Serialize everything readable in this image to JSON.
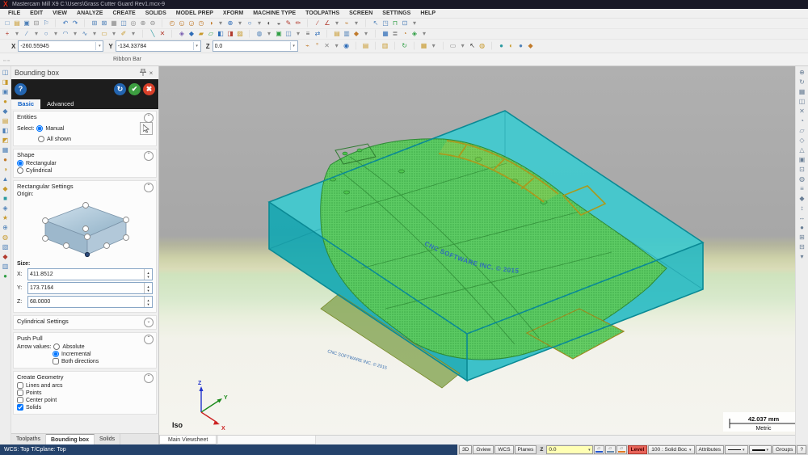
{
  "window": {
    "title": "Mastercam Mill X9   C:\\Users\\Grass Cutter Guard Rev1.mcx-9"
  },
  "menu": {
    "items": [
      "FILE",
      "EDIT",
      "VIEW",
      "ANALYZE",
      "CREATE",
      "SOLIDS",
      "MODEL PREP",
      "XFORM",
      "MACHINE TYPE",
      "TOOLPATHS",
      "SCREEN",
      "SETTINGS",
      "HELP"
    ]
  },
  "toolbars": {
    "row1": [
      {
        "g": "□",
        "c": "#4f81b8"
      },
      {
        "g": "▤",
        "c": "#c8992b"
      },
      {
        "g": "▣",
        "c": "#4f81b8"
      },
      {
        "g": "⊟",
        "c": "#8a8a8a"
      },
      {
        "g": "⚐",
        "c": "#4f81b8"
      },
      {
        "g": "│",
        "c": "#d5d5d5"
      },
      {
        "g": "↶",
        "c": "#2f6db8"
      },
      {
        "g": "↷",
        "c": "#2f6db8"
      },
      {
        "g": "│",
        "c": "#d5d5d5"
      },
      {
        "g": "⊞",
        "c": "#4f81b8"
      },
      {
        "g": "⊠",
        "c": "#4f81b8"
      },
      {
        "g": "▦",
        "c": "#8a8a8a"
      },
      {
        "g": "◫",
        "c": "#4f81b8"
      },
      {
        "g": "◎",
        "c": "#8a8a8a"
      },
      {
        "g": "⊕",
        "c": "#8a8a8a"
      },
      {
        "g": "⊖",
        "c": "#8a8a8a"
      },
      {
        "g": "│",
        "c": "#d5d5d5"
      },
      {
        "g": "◴",
        "c": "#c07a2a"
      },
      {
        "g": "◵",
        "c": "#c07a2a"
      },
      {
        "g": "◶",
        "c": "#c07a2a"
      },
      {
        "g": "◷",
        "c": "#c07a2a"
      },
      {
        "g": "◑",
        "c": "#c07a2a"
      },
      {
        "g": "▾",
        "c": "#888888"
      },
      {
        "g": "⊕",
        "c": "#2f6db8"
      },
      {
        "g": "▾",
        "c": "#888888"
      },
      {
        "g": "○",
        "c": "#2f6db8"
      },
      {
        "g": "▾",
        "c": "#888888"
      },
      {
        "g": "◐",
        "c": "#555555"
      },
      {
        "g": "◒",
        "c": "#555555"
      },
      {
        "g": "✎",
        "c": "#b23b2e"
      },
      {
        "g": "✏",
        "c": "#b23b2e"
      },
      {
        "g": "│",
        "c": "#d5d5d5"
      },
      {
        "g": "∕",
        "c": "#b23b2e"
      },
      {
        "g": "∠",
        "c": "#b23b2e"
      },
      {
        "g": "▾",
        "c": "#888888"
      },
      {
        "g": "⌁",
        "c": "#c07a2a"
      },
      {
        "g": "▾",
        "c": "#888888"
      },
      {
        "g": "│",
        "c": "#d5d5d5"
      },
      {
        "g": "↖",
        "c": "#4f81b8"
      },
      {
        "g": "◳",
        "c": "#4f81b8"
      },
      {
        "g": "⊓",
        "c": "#2f9e44"
      },
      {
        "g": "⊡",
        "c": "#4f81b8"
      },
      {
        "g": "▾",
        "c": "#888888"
      }
    ],
    "row2": [
      {
        "g": "+",
        "c": "#b23b2e"
      },
      {
        "g": "▾",
        "c": "#888888"
      },
      {
        "g": "∕",
        "c": "#4f81b8"
      },
      {
        "g": "▾",
        "c": "#888888"
      },
      {
        "g": "○",
        "c": "#4f81b8"
      },
      {
        "g": "▾",
        "c": "#888888"
      },
      {
        "g": "◠",
        "c": "#4f81b8"
      },
      {
        "g": "▾",
        "c": "#888888"
      },
      {
        "g": "∿",
        "c": "#4f81b8"
      },
      {
        "g": "▾",
        "c": "#888888"
      },
      {
        "g": "▭",
        "c": "#c8992b"
      },
      {
        "g": "▾",
        "c": "#888888"
      },
      {
        "g": "✐",
        "c": "#c8992b"
      },
      {
        "g": "▾",
        "c": "#888888"
      },
      {
        "g": "│",
        "c": "#d5d5d5"
      },
      {
        "g": "╲",
        "c": "#2b9aa0"
      },
      {
        "g": "✕",
        "c": "#b23b2e"
      },
      {
        "g": "│",
        "c": "#d5d5d5"
      },
      {
        "g": "◈",
        "c": "#7a5fb0"
      },
      {
        "g": "◆",
        "c": "#2f6db8"
      },
      {
        "g": "▰",
        "c": "#c8992b"
      },
      {
        "g": "▱",
        "c": "#2f9e44"
      },
      {
        "g": "◧",
        "c": "#2f6db8"
      },
      {
        "g": "◨",
        "c": "#b23b2e"
      },
      {
        "g": "▨",
        "c": "#c8992b"
      },
      {
        "g": "│",
        "c": "#d5d5d5"
      },
      {
        "g": "◍",
        "c": "#4f81b8"
      },
      {
        "g": "▾",
        "c": "#888888"
      },
      {
        "g": "▣",
        "c": "#2f9e44"
      },
      {
        "g": "◫",
        "c": "#4f81b8"
      },
      {
        "g": "▾",
        "c": "#888888"
      },
      {
        "g": "≡",
        "c": "#555555"
      },
      {
        "g": "⇄",
        "c": "#2f6db8"
      },
      {
        "g": "│",
        "c": "#d5d5d5"
      },
      {
        "g": "▤",
        "c": "#c8992b"
      },
      {
        "g": "▥",
        "c": "#4f81b8"
      },
      {
        "g": "◆",
        "c": "#c07a2a"
      },
      {
        "g": "▾",
        "c": "#888888"
      },
      {
        "g": "│",
        "c": "#d5d5d5"
      },
      {
        "g": "▦",
        "c": "#2f6db8"
      },
      {
        "g": "≣",
        "c": "#555555"
      },
      {
        "g": "◔",
        "c": "#c07a2a"
      },
      {
        "g": "◈",
        "c": "#2f9e44"
      },
      {
        "g": "▾",
        "c": "#888888"
      }
    ],
    "coord_extra": [
      {
        "g": "⌁",
        "c": "#c07a2a"
      },
      {
        "g": "°",
        "c": "#c07a2a"
      },
      {
        "g": "✕",
        "c": "#888888"
      },
      {
        "g": "▾",
        "c": "#888888"
      },
      {
        "g": "◉",
        "c": "#2f6db8"
      },
      {
        "g": "│",
        "c": "#d5d5d5"
      },
      {
        "g": "▤",
        "c": "#c8992b"
      },
      {
        "g": "│",
        "c": "#d5d5d5"
      },
      {
        "g": "▥",
        "c": "#c8992b"
      },
      {
        "g": "│",
        "c": "#d5d5d5"
      },
      {
        "g": "↻",
        "c": "#2f9e44"
      },
      {
        "g": "│",
        "c": "#d5d5d5"
      },
      {
        "g": "▦",
        "c": "#c8992b"
      },
      {
        "g": "▾",
        "c": "#888888"
      },
      {
        "g": "│",
        "c": "#d5d5d5"
      },
      {
        "g": "▭",
        "c": "#888888"
      },
      {
        "g": "▾",
        "c": "#888888"
      },
      {
        "g": "↖",
        "c": "#333333"
      },
      {
        "g": "◍",
        "c": "#c8992b"
      },
      {
        "g": "│",
        "c": "#d5d5d5"
      },
      {
        "g": "●",
        "c": "#2b9aa0"
      },
      {
        "g": "◐",
        "c": "#c8992b"
      },
      {
        "g": "●",
        "c": "#4f81b8"
      },
      {
        "g": "◆",
        "c": "#c07a2a"
      }
    ],
    "left_strip": [
      {
        "g": "◫",
        "c": "#4f81b8"
      },
      {
        "g": "◨",
        "c": "#c8992b"
      },
      {
        "g": "▣",
        "c": "#4f81b8"
      },
      {
        "g": "●",
        "c": "#c8992b"
      },
      {
        "g": "◆",
        "c": "#4f81b8"
      },
      {
        "g": "▤",
        "c": "#c8992b"
      },
      {
        "g": "◧",
        "c": "#4f81b8"
      },
      {
        "g": "◩",
        "c": "#c8992b"
      },
      {
        "g": "▦",
        "c": "#4f81b8"
      },
      {
        "g": "●",
        "c": "#c07a2a"
      },
      {
        "g": "◑",
        "c": "#c8992b"
      },
      {
        "g": "▲",
        "c": "#4f81b8"
      },
      {
        "g": "◆",
        "c": "#c8992b"
      },
      {
        "g": "■",
        "c": "#2b9aa0"
      },
      {
        "g": "◈",
        "c": "#4f81b8"
      },
      {
        "g": "★",
        "c": "#c8992b"
      },
      {
        "g": "⊕",
        "c": "#4f81b8"
      },
      {
        "g": "◍",
        "c": "#c8992b"
      },
      {
        "g": "▧",
        "c": "#4f81b8"
      },
      {
        "g": "◆",
        "c": "#b23b2e"
      },
      {
        "g": "▥",
        "c": "#4f81b8"
      },
      {
        "g": "●",
        "c": "#2f9e44"
      }
    ],
    "right_strip": [
      {
        "g": "⊕",
        "c": "#6a7f96"
      },
      {
        "g": "↻",
        "c": "#6a7f96"
      },
      {
        "g": "▦",
        "c": "#6a7f96"
      },
      {
        "g": "◫",
        "c": "#6a7f96"
      },
      {
        "g": "✕",
        "c": "#6a7f96"
      },
      {
        "g": "◔",
        "c": "#6a7f96"
      },
      {
        "g": "▱",
        "c": "#6a7f96"
      },
      {
        "g": "◇",
        "c": "#6a7f96"
      },
      {
        "g": "△",
        "c": "#6a7f96"
      },
      {
        "g": "▣",
        "c": "#6a7f96"
      },
      {
        "g": "⊡",
        "c": "#6a7f96"
      },
      {
        "g": "◍",
        "c": "#6a7f96"
      },
      {
        "g": "≡",
        "c": "#6a7f96"
      },
      {
        "g": "◆",
        "c": "#6a7f96"
      },
      {
        "g": "↕",
        "c": "#6a7f96"
      },
      {
        "g": "↔",
        "c": "#6a7f96"
      },
      {
        "g": "●",
        "c": "#6a7f96"
      },
      {
        "g": "⊞",
        "c": "#6a7f96"
      },
      {
        "g": "⊟",
        "c": "#6a7f96"
      },
      {
        "g": "▾",
        "c": "#6a7f96"
      }
    ]
  },
  "coords": {
    "x_label": "X",
    "x_value": "-260.55945",
    "y_label": "Y",
    "y_value": "-134.33784",
    "z_label": "Z",
    "z_value": "0.0"
  },
  "ribbon_bar_label": "Ribbon Bar",
  "panel": {
    "title": "Bounding box",
    "help_glyph": "?",
    "tabs": {
      "basic": "Basic",
      "advanced": "Advanced"
    },
    "entities": {
      "title": "Entities",
      "select_label": "Select:",
      "manual": {
        "label": "Manual",
        "checked": true
      },
      "all_shown": {
        "label": "All shown",
        "checked": false
      }
    },
    "shape": {
      "title": "Shape",
      "rectangular": {
        "label": "Rectangular",
        "checked": true
      },
      "cylindrical": {
        "label": "Cylindrical",
        "checked": false
      }
    },
    "rect": {
      "title": "Rectangular Settings",
      "origin_label": "Origin:",
      "size_label": "Size:",
      "x": {
        "label": "X:",
        "value": "411.8512"
      },
      "y": {
        "label": "Y:",
        "value": "173.7164"
      },
      "z": {
        "label": "Z:",
        "value": "68.0000"
      }
    },
    "cyl": {
      "title": "Cylindrical Settings"
    },
    "pushpull": {
      "title": "Push Pull",
      "arrow_label": "Arrow values:",
      "absolute": {
        "label": "Absolute",
        "checked": false
      },
      "incremental": {
        "label": "Incremental",
        "checked": true
      },
      "both": {
        "label": "Both directions",
        "checked": false
      }
    },
    "geometry": {
      "title": "Create Geometry",
      "lines": {
        "label": "Lines and arcs",
        "checked": false
      },
      "points": {
        "label": "Points",
        "checked": false
      },
      "center": {
        "label": "Center point",
        "checked": false
      },
      "solids": {
        "label": "Solids",
        "checked": true
      }
    }
  },
  "bottom_tabs": {
    "toolpaths": "Toolpaths",
    "bounding": "Bounding box",
    "solids": "Solids"
  },
  "viewsheet_tab": "Main Viewsheet",
  "viewport": {
    "watermark": "CNC SOFTWARE INC. © 2015",
    "view_label": "Iso",
    "scale_value": "42.037 mm",
    "scale_units": "Metric",
    "axis": {
      "x": "X",
      "y": "Y",
      "z": "Z"
    }
  },
  "statusbar": {
    "left_text": "WCS: Top  T/Cplane: Top",
    "buttons": [
      {
        "label": "3D"
      },
      {
        "label": "Gview"
      },
      {
        "label": "WCS"
      },
      {
        "label": "Planes"
      }
    ],
    "z_label": "Z",
    "z_value": "0.0",
    "color_buttons": [
      {
        "c": "#2255cc"
      },
      {
        "c": "#6688aa"
      },
      {
        "c": "#e07820"
      }
    ],
    "level_label": "Level",
    "level_value": "100 : Solid Boc",
    "attributes_label": "Attributes",
    "groups_label": "Groups",
    "help_label": "?"
  },
  "colors": {
    "accent_blue": "#2365b0",
    "box_teal": "#36ccd2",
    "part_green": "#5ecb5e",
    "status_bg": "#24426b",
    "highlight_yellow": "#ffffb4"
  }
}
